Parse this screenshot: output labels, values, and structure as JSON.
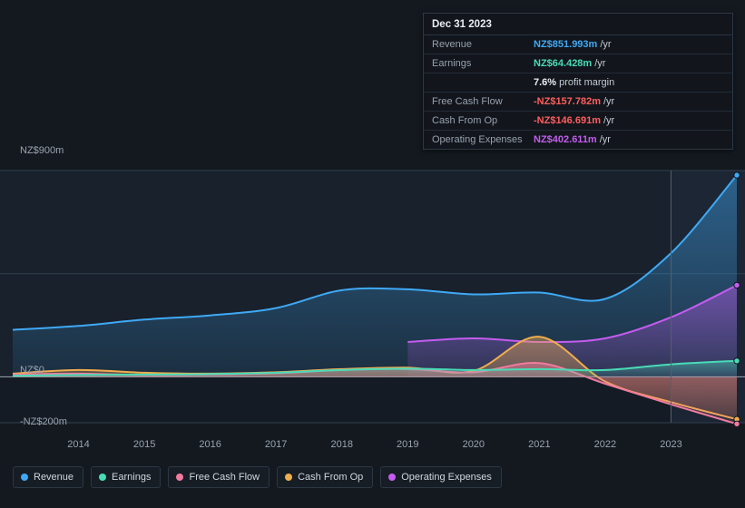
{
  "tooltip": {
    "date": "Dec 31 2023",
    "rows": [
      {
        "label": "Revenue",
        "value": "NZ$851.993m",
        "unit": "/yr",
        "color": "#3fa9f5"
      },
      {
        "label": "Earnings",
        "value": "NZ$64.428m",
        "unit": "/yr",
        "color": "#49dbb6"
      },
      {
        "label": "",
        "value": "7.6%",
        "unit": "profit margin",
        "color": "#e9edf2"
      },
      {
        "label": "Free Cash Flow",
        "value": "-NZ$157.782m",
        "unit": "/yr",
        "color": "#ff5d5d"
      },
      {
        "label": "Cash From Op",
        "value": "-NZ$146.691m",
        "unit": "/yr",
        "color": "#ff5d5d"
      },
      {
        "label": "Operating Expenses",
        "value": "NZ$402.611m",
        "unit": "/yr",
        "color": "#c45cf0"
      }
    ]
  },
  "axes": {
    "y_top": "NZ$900m",
    "y_zero": "NZ$0",
    "y_bottom": "-NZ$200m",
    "x_ticks": [
      "2014",
      "2015",
      "2016",
      "2017",
      "2018",
      "2019",
      "2020",
      "2021",
      "2022",
      "2023"
    ]
  },
  "legend": [
    {
      "label": "Revenue",
      "color": "#3fa9f5"
    },
    {
      "label": "Earnings",
      "color": "#49dbb6"
    },
    {
      "label": "Free Cash Flow",
      "color": "#f07ba0"
    },
    {
      "label": "Cash From Op",
      "color": "#f0ad4e"
    },
    {
      "label": "Operating Expenses",
      "color": "#c45cf0"
    }
  ],
  "chart_data": {
    "type": "area",
    "title": "",
    "xlabel": "",
    "ylabel": "NZ$",
    "ylim": [
      -200,
      900
    ],
    "yticks": [
      -200,
      0,
      900
    ],
    "grid": true,
    "legend_position": "bottom",
    "x": [
      "2013",
      "2014",
      "2015",
      "2016",
      "2017",
      "2018",
      "2019",
      "2020",
      "2021",
      "2022",
      "2023",
      "2024"
    ],
    "forecast_start": "2023",
    "series": [
      {
        "name": "Revenue",
        "color": "#3fa9f5",
        "values": [
          205,
          222,
          250,
          268,
          300,
          378,
          382,
          360,
          368,
          340,
          540,
          880
        ]
      },
      {
        "name": "Earnings",
        "color": "#49dbb6",
        "values": [
          5,
          8,
          10,
          12,
          18,
          30,
          36,
          30,
          34,
          30,
          55,
          70
        ]
      },
      {
        "name": "Free Cash Flow",
        "color": "#f07ba0",
        "values": [
          10,
          14,
          8,
          10,
          16,
          30,
          34,
          20,
          60,
          -30,
          -120,
          -205
        ]
      },
      {
        "name": "Cash From Op",
        "color": "#f0ad4e",
        "values": [
          14,
          30,
          18,
          14,
          20,
          34,
          40,
          26,
          175,
          -20,
          -110,
          -185
        ]
      },
      {
        "name": "Operating Expenses",
        "color": "#c45cf0",
        "values": [
          null,
          null,
          null,
          null,
          null,
          null,
          152,
          168,
          152,
          168,
          260,
          400
        ]
      }
    ]
  }
}
